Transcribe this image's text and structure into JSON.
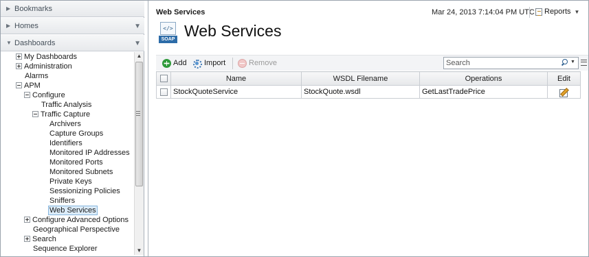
{
  "left_pane": {
    "bookmarks_label": "Bookmarks",
    "homes_label": "Homes",
    "dashboards_label": "Dashboards"
  },
  "tree": [
    {
      "label": "My Dashboards",
      "toggle": "plus"
    },
    {
      "label": "Administration",
      "toggle": "plus"
    },
    {
      "label": "Alarms",
      "toggle": "none"
    },
    {
      "label": "APM",
      "toggle": "minus"
    },
    {
      "label": "Configure",
      "toggle": "minus"
    },
    {
      "label": "Traffic Analysis",
      "toggle": "none"
    },
    {
      "label": "Traffic Capture",
      "toggle": "minus"
    },
    {
      "label": "Archivers",
      "toggle": "none"
    },
    {
      "label": "Capture Groups",
      "toggle": "none"
    },
    {
      "label": "Identifiers",
      "toggle": "none"
    },
    {
      "label": "Monitored IP Addresses",
      "toggle": "none"
    },
    {
      "label": "Monitored Ports",
      "toggle": "none"
    },
    {
      "label": "Monitored Subnets",
      "toggle": "none"
    },
    {
      "label": "Private Keys",
      "toggle": "none"
    },
    {
      "label": "Sessionizing Policies",
      "toggle": "none"
    },
    {
      "label": "Sniffers",
      "toggle": "none"
    },
    {
      "label": "Web Services",
      "toggle": "none",
      "selected": true
    },
    {
      "label": "Configure Advanced Options",
      "toggle": "plus"
    },
    {
      "label": "Geographical Perspective",
      "toggle": "none"
    },
    {
      "label": "Search",
      "toggle": "plus"
    },
    {
      "label": "Sequence Explorer",
      "toggle": "none"
    }
  ],
  "header": {
    "breadcrumb": "Web Services",
    "timestamp": "Mar 24, 2013 7:14:04 PM UTC",
    "reports_label": "Reports",
    "page_title": "Web Services",
    "soap_code": "</>",
    "soap_label": "SOAP"
  },
  "toolbar": {
    "add_label": "Add",
    "import_label": "Import",
    "remove_label": "Remove",
    "search_placeholder": "Search"
  },
  "table": {
    "columns": [
      "Name",
      "WSDL Filename",
      "Operations",
      "Edit"
    ],
    "rows": [
      {
        "name": "StockQuoteService",
        "wsdl": "StockQuote.wsdl",
        "operations": "GetLastTradePrice"
      }
    ]
  },
  "colors": {
    "accent": "#2d6ca8",
    "selection": "#dcecf9",
    "add_green": "#2e9a3a"
  }
}
